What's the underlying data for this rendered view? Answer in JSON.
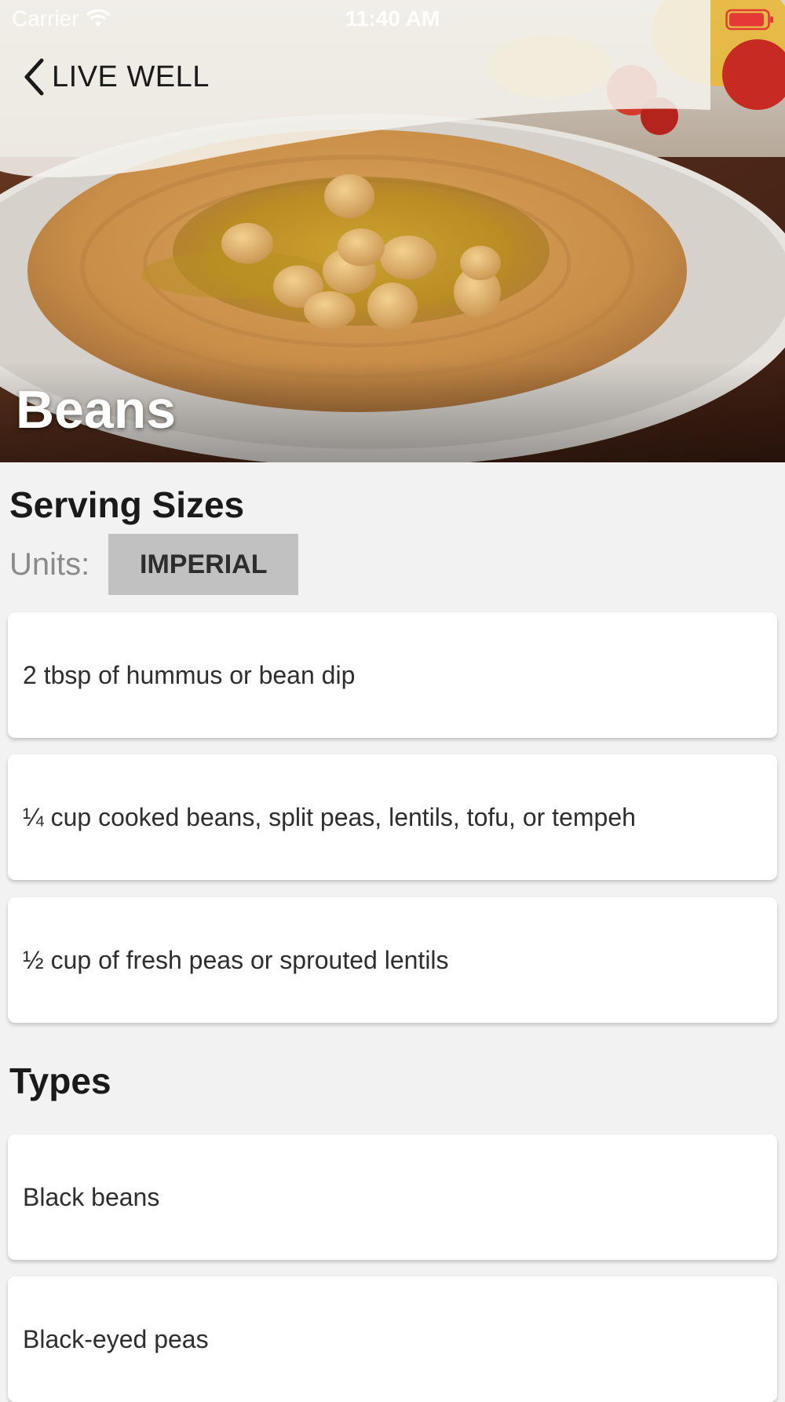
{
  "status_bar": {
    "carrier": "Carrier",
    "time": "11:40 AM",
    "battery_color": "#e53935"
  },
  "nav": {
    "back_label": "LIVE WELL",
    "back_icon": "chevron-left-icon"
  },
  "hero": {
    "title": "Beans",
    "image": "hummus-with-chickpeas-photo"
  },
  "serving_sizes": {
    "heading": "Serving Sizes",
    "units_label": "Units:",
    "units_value": "IMPERIAL",
    "items": [
      "2 tbsp of hummus or bean dip",
      "¼ cup cooked beans, split peas, lentils, tofu, or tempeh",
      "½ cup of fresh peas or sprouted lentils"
    ]
  },
  "types": {
    "heading": "Types",
    "items": [
      "Black beans",
      "Black-eyed peas"
    ]
  }
}
